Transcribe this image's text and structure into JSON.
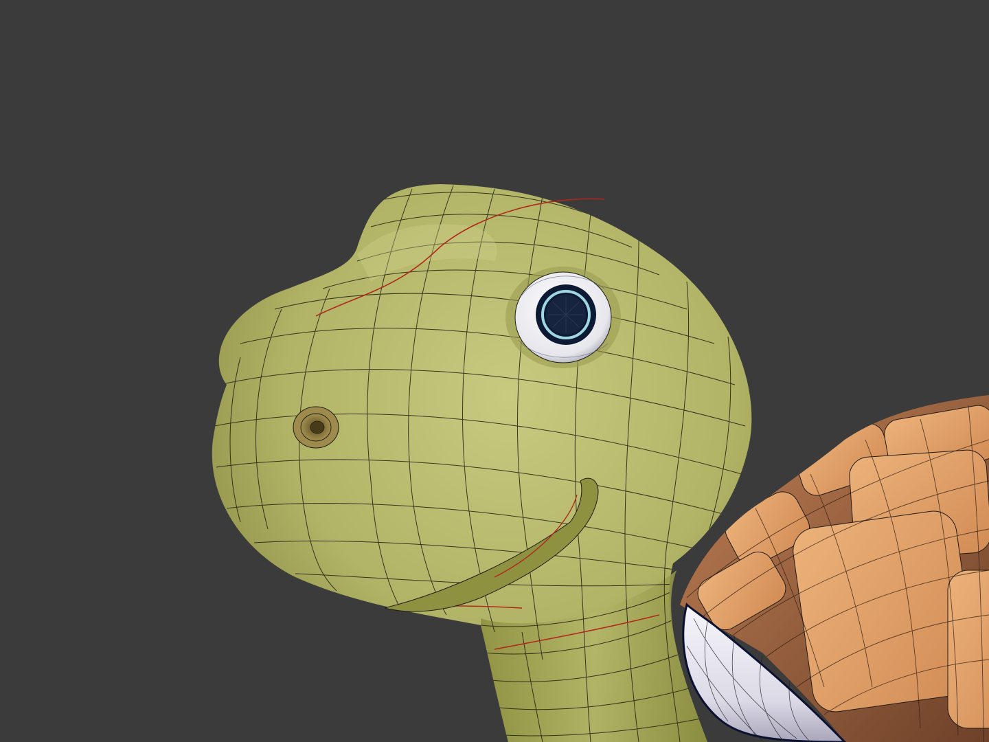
{
  "scene": {
    "subject": "turtle-model",
    "display_mode": "wireframe-overlay",
    "background_color": "#3b3b3b"
  },
  "colors": {
    "skin_light": "#c4c67a",
    "skin_mid": "#a9ab5e",
    "skin_dark": "#6f7232",
    "wire": "#1f1f12",
    "seam": "#b0281c",
    "shell_plate": "#d9965e",
    "shell_plate_light": "#e9ad74",
    "shell_groove": "#7a4a33",
    "shell_dark": "#5e3826",
    "belly_white": "#f2f1f6",
    "belly_shadow": "#b8b5c8",
    "eye_white": "#f4f4f6",
    "iris_ring": "#9fd6e0",
    "pupil": "#0c1a33",
    "nostril": "#6e5a2a"
  }
}
